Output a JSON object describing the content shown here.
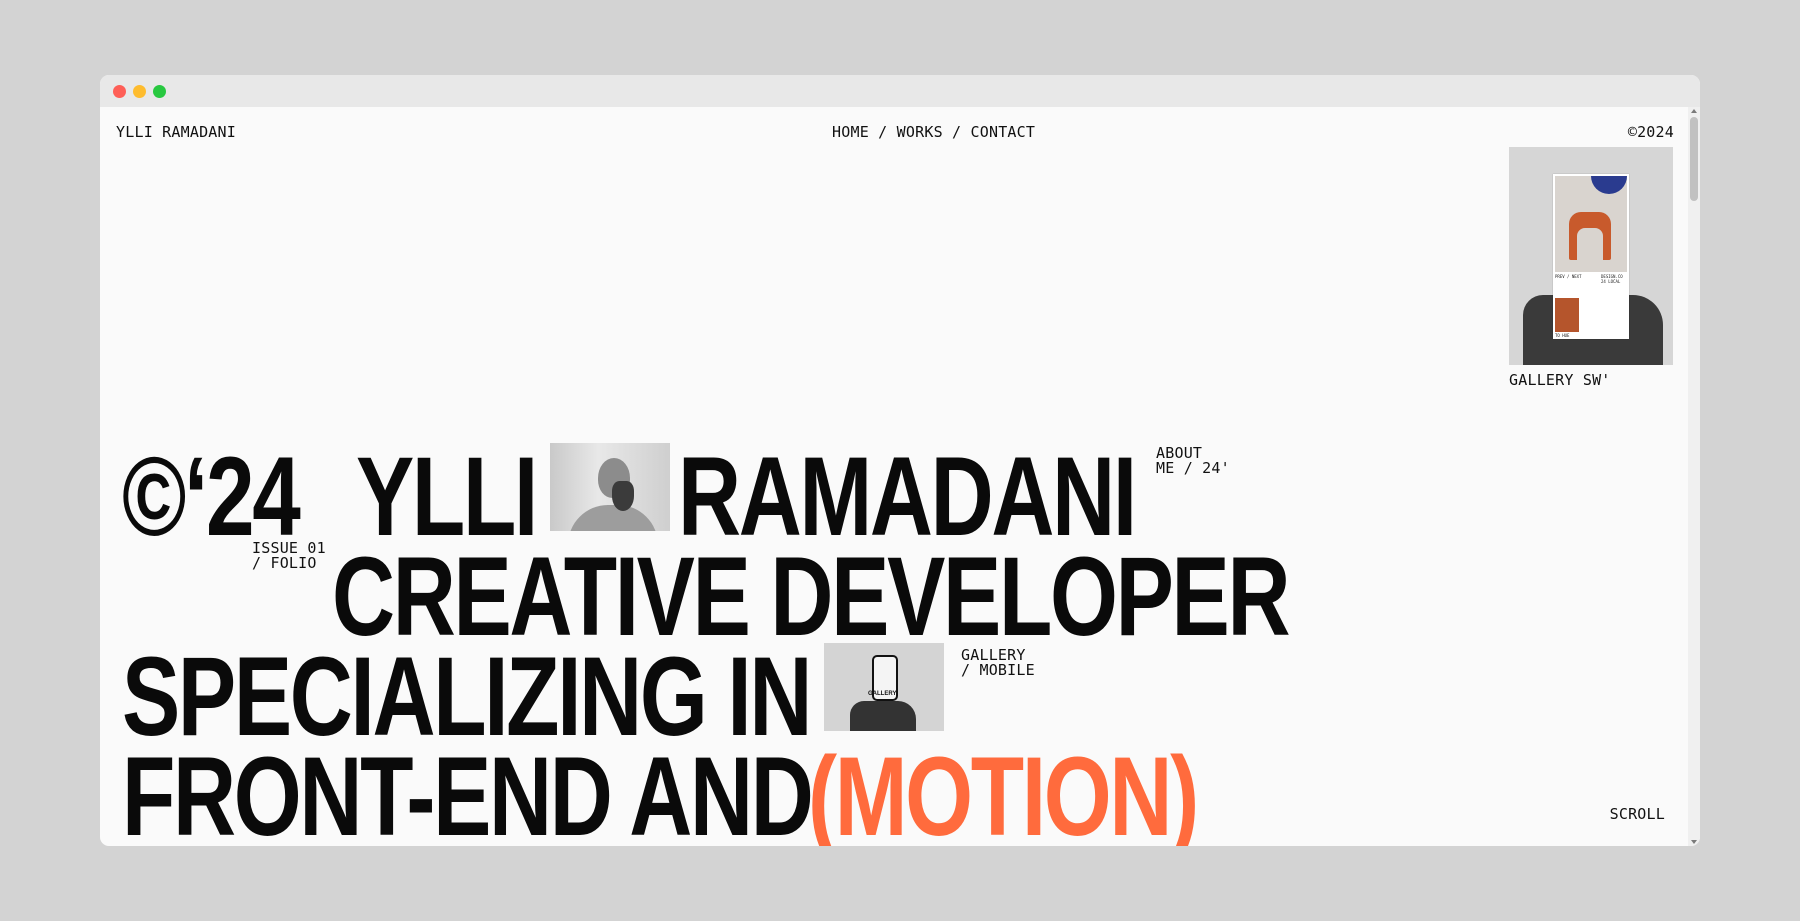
{
  "header": {
    "brand": "YLLI RAMADANI",
    "nav": [
      {
        "label": "HOME"
      },
      {
        "label": "WORKS"
      },
      {
        "label": "CONTACT"
      }
    ],
    "nav_separator": " / ",
    "copyright": "©2024"
  },
  "gallery_top": {
    "label": "GALLERY SW'",
    "paper_caption_left": "PREV / NEXT",
    "paper_caption_right": "DESIGN.CO 24 LOCAL",
    "paper_caption_bottom": "TO HUE"
  },
  "hero": {
    "line1_copy": "©‘24",
    "line1_first": "YLLI",
    "line1_last": "RAMADANI",
    "line2": "CREATIVE DEVELOPER",
    "line3": "SPECIALIZING IN",
    "line4_prefix": "FRONT-END AND",
    "line4_accent": "(MOTION)",
    "about_label_1": "ABOUT",
    "about_label_2": "ME / 24'",
    "issue_label_1": "ISSUE 01",
    "issue_label_2": "/ FOLIO",
    "gallery_label_1": "GALLERY",
    "gallery_label_2": "/ MOBILE",
    "phone_caption": "GALLERY"
  },
  "footer": {
    "scroll": "SCROLL"
  },
  "colors": {
    "accent": "#ff6b3d",
    "background": "#fafafa",
    "text": "#0a0a0a"
  }
}
